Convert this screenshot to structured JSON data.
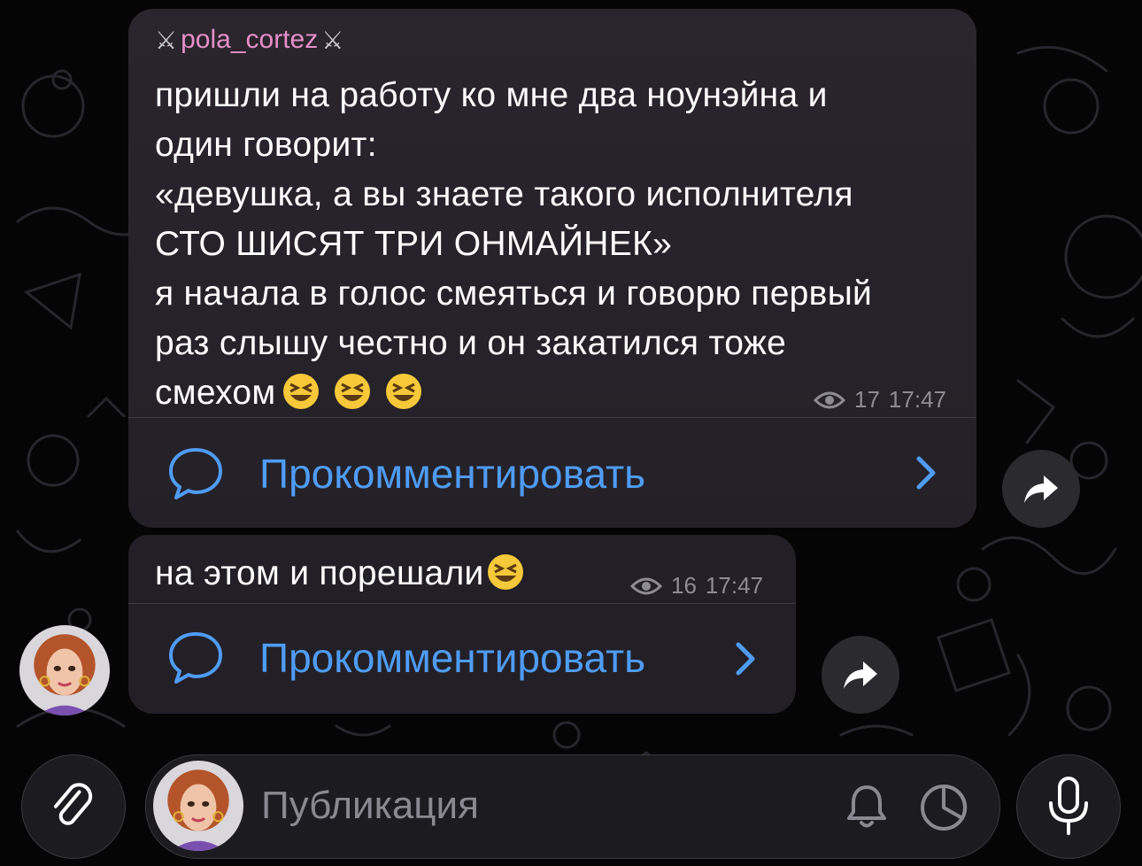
{
  "colors": {
    "accent": "#4f9cf4",
    "sender_name": "#e58fc8",
    "bubble": "#222026",
    "meta": "#8e8c93",
    "background": "#050505"
  },
  "messages": [
    {
      "sender": "pola_cortez",
      "sender_decoration_icon": "crossed-swords-icon",
      "text": "пришли на работу ко мне два ноунэйна и\nодин говорит:\n«девушка, а вы знаете такого исполнителя\nСТО ШИСЯТ ТРИ ОНМАЙНЕК»\nя начала в голос смеяться и говорю первый\nраз слышу честно и он закатился тоже\nсмехом",
      "emoji_count": 3,
      "views": "17",
      "time": "17:47",
      "comment_label": "Прокомментировать"
    },
    {
      "text": "на этом и порешали",
      "emoji_count": 1,
      "views": "16",
      "time": "17:47",
      "comment_label": "Прокомментировать"
    }
  ],
  "input": {
    "placeholder": "Публикация"
  },
  "icons": {
    "attach": "paperclip-icon",
    "notify": "bell-icon",
    "timer": "timer-icon",
    "voice": "microphone-icon",
    "share": "share-arrow-icon",
    "views": "eye-icon",
    "comment": "comment-bubble-icon"
  }
}
